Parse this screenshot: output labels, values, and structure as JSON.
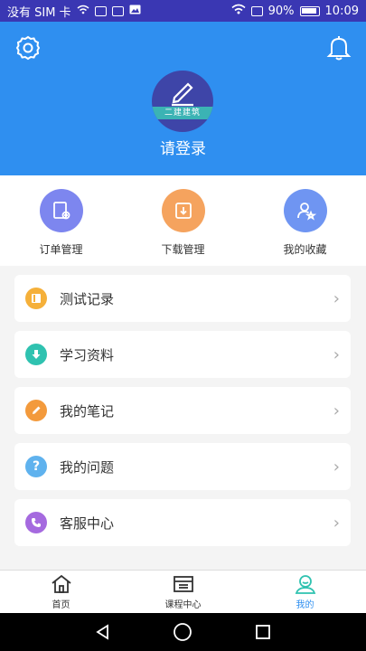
{
  "status_bar": {
    "carrier": "没有 SIM 卡",
    "battery": "90%",
    "time": "10:09"
  },
  "header": {
    "avatar_ribbon": "二建建筑",
    "login_text": "请登录"
  },
  "quick_actions": [
    {
      "label": "订单管理",
      "color": "#7d86ef"
    },
    {
      "label": "下载管理",
      "color": "#f5a35e"
    },
    {
      "label": "我的收藏",
      "color": "#6f95f2"
    }
  ],
  "menu": [
    {
      "label": "测试记录",
      "color": "#f5b03a",
      "icon": "notebook-icon"
    },
    {
      "label": "学习资料",
      "color": "#2fc2b0",
      "icon": "download-icon"
    },
    {
      "label": "我的笔记",
      "color": "#f39a3c",
      "icon": "pencil-icon"
    },
    {
      "label": "我的问题",
      "color": "#5fb2ee",
      "icon": "question-icon"
    },
    {
      "label": "客服中心",
      "color": "#a56adf",
      "icon": "phone-icon"
    }
  ],
  "tabs": [
    {
      "label": "首页"
    },
    {
      "label": "课程中心"
    },
    {
      "label": "我的"
    }
  ],
  "colors": {
    "primary": "#2f8ff0",
    "statusbar": "#3a37b3"
  }
}
